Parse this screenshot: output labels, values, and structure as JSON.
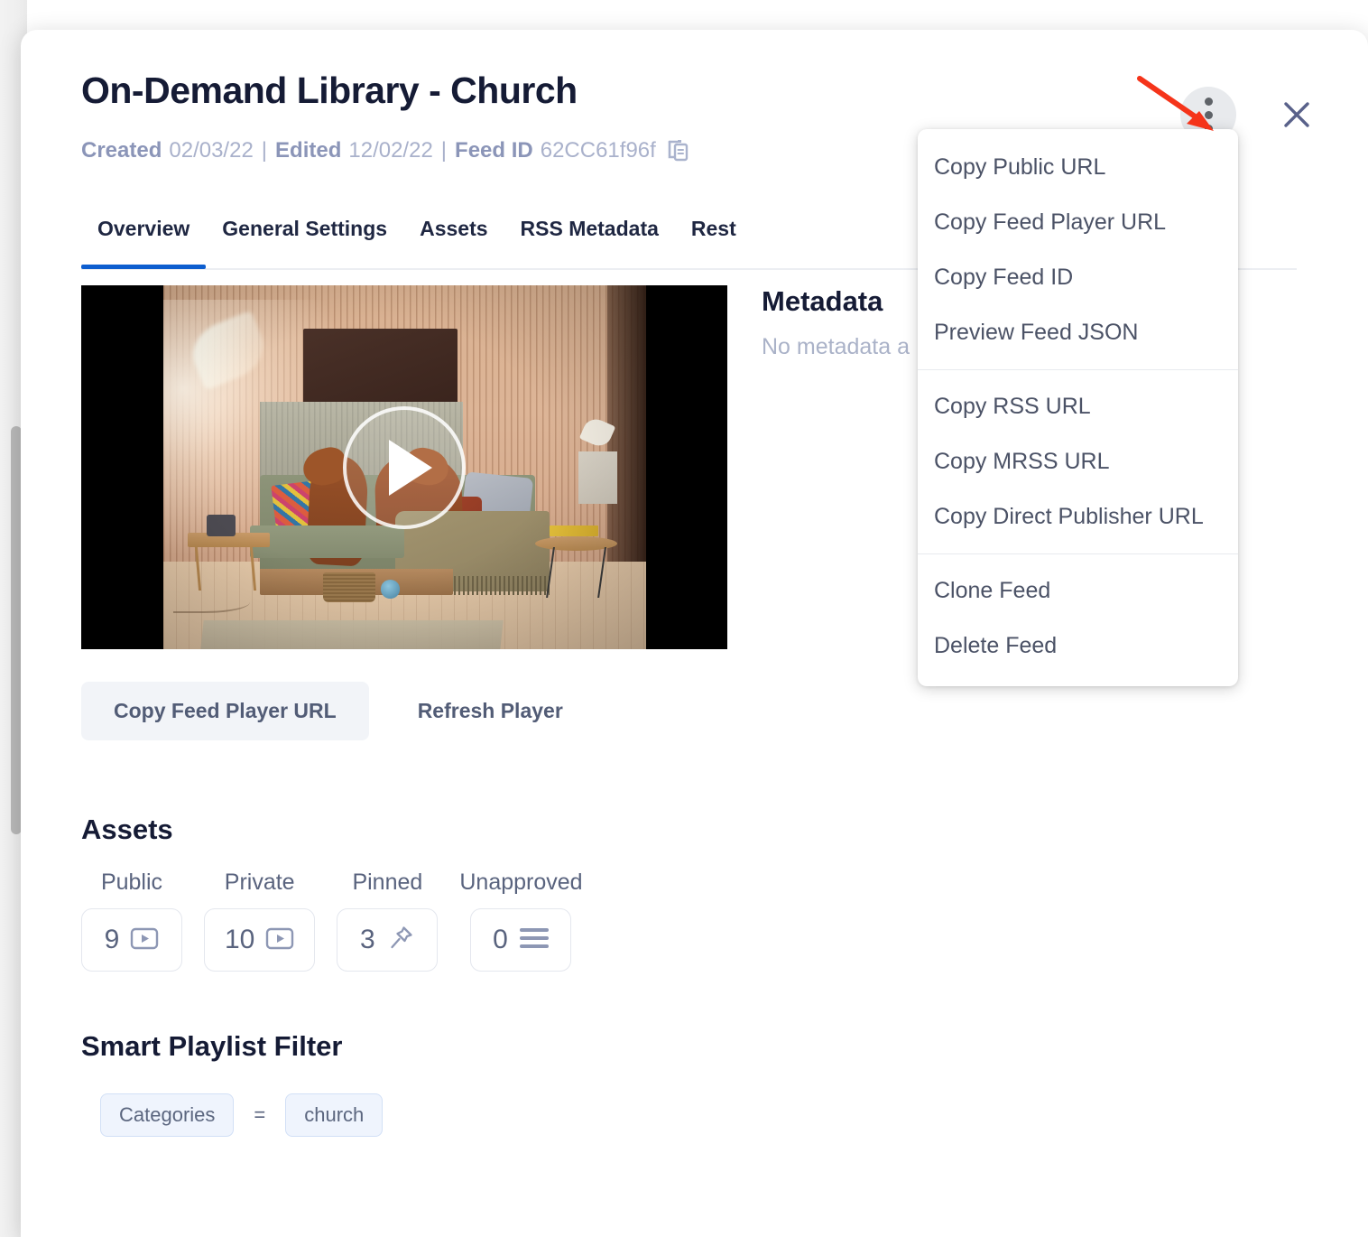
{
  "dialog": {
    "title": "On-Demand Library - Church",
    "meta": {
      "created_label": "Created",
      "created_value": "02/03/22",
      "separator": "|",
      "edited_label": "Edited",
      "edited_value": "12/02/22",
      "feed_id_label": "Feed ID",
      "feed_id_value": "62CC61f96f",
      "copy_icon": "copy-clipboard-icon"
    },
    "kebab_icon": "more-vertical-icon",
    "close_icon": "close-icon"
  },
  "tabs": [
    {
      "label": "Overview",
      "active": true
    },
    {
      "label": "General Settings",
      "active": false
    },
    {
      "label": "Assets",
      "active": false
    },
    {
      "label": "RSS Metadata",
      "active": false
    },
    {
      "label": "Rest",
      "active": false
    }
  ],
  "player": {
    "play_icon": "play-button-icon",
    "actions": [
      {
        "label": "Copy Feed Player URL",
        "style": "soft"
      },
      {
        "label": "Refresh Player",
        "style": "plain"
      }
    ]
  },
  "metadata": {
    "title": "Metadata",
    "empty_text": "No metadata a"
  },
  "assets": {
    "heading": "Assets",
    "stats": [
      {
        "label": "Public",
        "count": "9",
        "icon": "video-play-icon"
      },
      {
        "label": "Private",
        "count": "10",
        "icon": "video-play-icon"
      },
      {
        "label": "Pinned",
        "count": "3",
        "icon": "pin-icon"
      },
      {
        "label": "Unapproved",
        "count": "0",
        "icon": "list-lines-icon"
      }
    ]
  },
  "smart_playlist_filter": {
    "heading": "Smart Playlist Filter",
    "field": "Categories",
    "operator": "=",
    "value": "church"
  },
  "menu": {
    "groups": [
      {
        "items": [
          "Copy Public URL",
          "Copy Feed Player URL",
          "Copy Feed ID",
          "Preview Feed JSON"
        ]
      },
      {
        "items": [
          "Copy RSS URL",
          "Copy MRSS URL",
          "Copy Direct Publisher URL"
        ]
      },
      {
        "items": [
          "Clone Feed",
          "Delete Feed"
        ]
      }
    ]
  },
  "annotation": {
    "arrow_color": "#f5341a",
    "arrow_target": "more-vertical-icon"
  },
  "colors": {
    "accent_blue": "#0d5ecf",
    "title_dark": "#151b35",
    "muted_slate": "#8b95b8",
    "body_slate": "#59637e",
    "chip_bg": "#eff4fd",
    "soft_button_bg": "#f2f4f8"
  }
}
